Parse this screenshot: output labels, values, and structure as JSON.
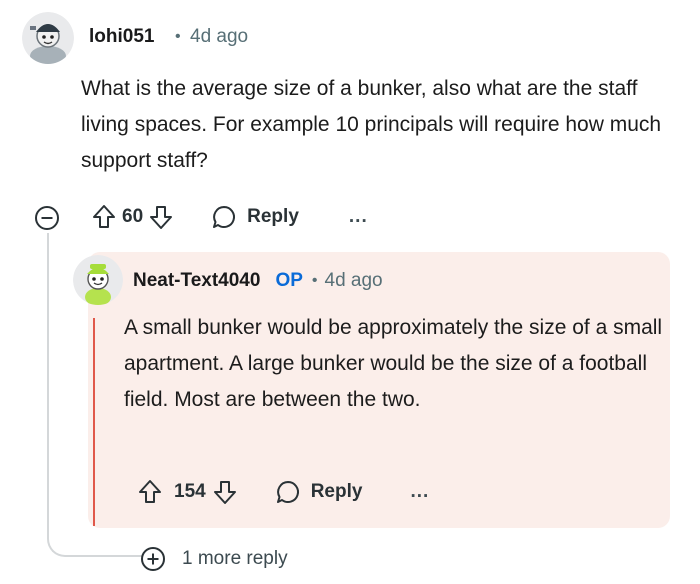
{
  "comment1": {
    "username": "lohi051",
    "separator": "•",
    "time": "4d ago",
    "body": "What is the average size of a bunker, also what are the staff living spaces. For example 10 principals will require how much support staff?",
    "votes": "60",
    "reply_label": "Reply",
    "more_label": "..."
  },
  "comment2": {
    "username": "Neat-Text4040",
    "badge": "OP",
    "separator": "•",
    "time": "4d ago",
    "body": "A small bunker would be approximately the size of a small apartment. A large bunker would be the size of a football field. Most are between the two.",
    "votes": "154",
    "reply_label": "Reply",
    "more_label": "...",
    "highlight_color": "#fbeeea"
  },
  "more_replies": {
    "label": "1 more reply"
  },
  "icons": [
    "collapse-icon",
    "upvote-icon",
    "downvote-icon",
    "reply-bubble-icon",
    "expand-plus-icon"
  ]
}
